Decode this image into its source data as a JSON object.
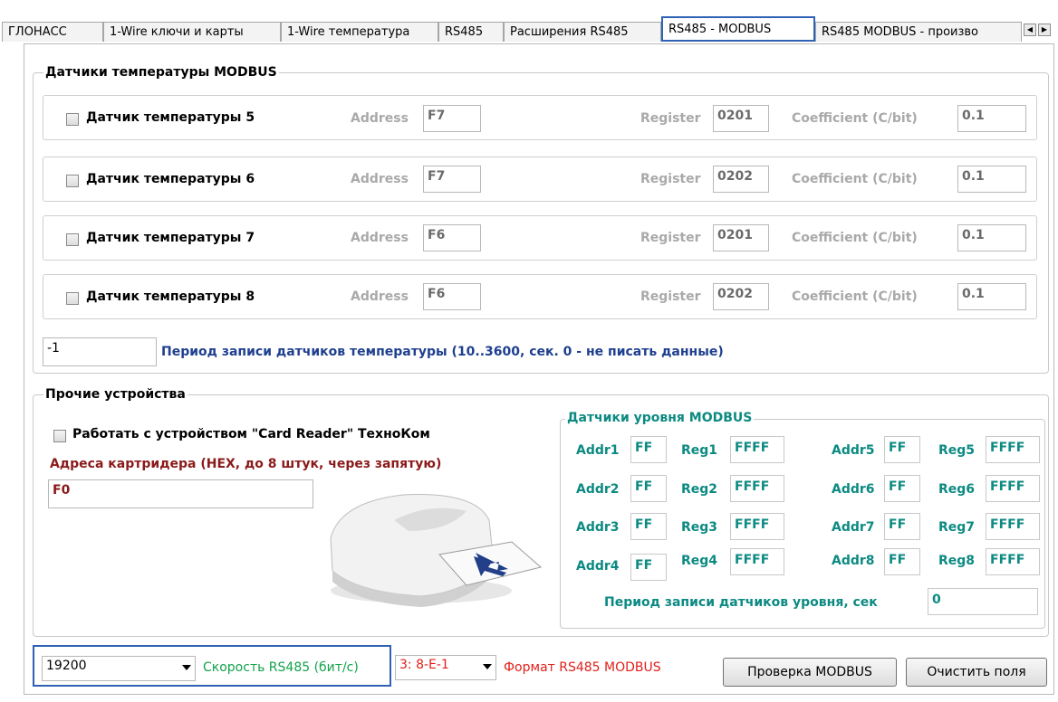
{
  "tabs": [
    {
      "label": "ГЛОНАСС"
    },
    {
      "label": "1-Wire ключи и карты"
    },
    {
      "label": "1-Wire температура"
    },
    {
      "label": "RS485"
    },
    {
      "label": "Расширения RS485"
    },
    {
      "label": "RS485 - MODBUS",
      "active": true
    },
    {
      "label": "RS485 MODBUS - произво"
    }
  ],
  "temp_group": {
    "title": "Датчики температуры MODBUS",
    "sensors": [
      {
        "label": "Датчик температуры 5",
        "address": "F7",
        "register": "0201",
        "coeff": "0.1"
      },
      {
        "label": "Датчик температуры 6",
        "address": "F7",
        "register": "0202",
        "coeff": "0.1"
      },
      {
        "label": "Датчик температуры 7",
        "address": "F6",
        "register": "0201",
        "coeff": "0.1"
      },
      {
        "label": "Датчик температуры 8",
        "address": "F6",
        "register": "0202",
        "coeff": "0.1"
      }
    ],
    "address_label": "Address",
    "register_label": "Register",
    "coeff_label": "Coefficient (C/bit)",
    "period_value": "-1",
    "period_label": "Период записи датчиков температуры (10..3600, сек. 0 - не писать данные)"
  },
  "other_group": {
    "title": "Прочие устройства",
    "card_reader_label": "Работать с устройством \"Card Reader\" ТехноКом",
    "addresses_label": "Адреса картридера (HEX, до 8 штук, через запятую)",
    "addresses_value": "F0"
  },
  "level_group": {
    "title": "Датчики уровня MODBUS",
    "left": [
      {
        "addr_label": "Addr1",
        "addr": "FF",
        "reg_label": "Reg1",
        "reg": "FFFF"
      },
      {
        "addr_label": "Addr2",
        "addr": "FF",
        "reg_label": "Reg2",
        "reg": "FFFF"
      },
      {
        "addr_label": "Addr3",
        "addr": "FF",
        "reg_label": "Reg3",
        "reg": "FFFF"
      },
      {
        "addr_label": "Addr4",
        "addr": "FF",
        "reg_label": "Reg4",
        "reg": "FFFF"
      }
    ],
    "right": [
      {
        "addr_label": "Addr5",
        "addr": "FF",
        "reg_label": "Reg5",
        "reg": "FFFF"
      },
      {
        "addr_label": "Addr6",
        "addr": "FF",
        "reg_label": "Reg6",
        "reg": "FFFF"
      },
      {
        "addr_label": "Addr7",
        "addr": "FF",
        "reg_label": "Reg7",
        "reg": "FFFF"
      },
      {
        "addr_label": "Addr8",
        "addr": "FF",
        "reg_label": "Reg8",
        "reg": "FFFF"
      }
    ],
    "period_label": "Период записи датчиков уровня, сек",
    "period_value": "0"
  },
  "bottom": {
    "speed_value": "19200",
    "speed_label": "Скорость RS485 (бит/с)",
    "format_value": "3:  8-E-1",
    "format_label": "Формат RS485 MODBUS",
    "check_button": "Проверка MODBUS",
    "clear_button": "Очистить поля"
  },
  "colors": {
    "active_tab": "#2f62b4",
    "label_blue": "#1f3f8f",
    "label_red": "#8b1a1a",
    "teal": "#0c8a82",
    "green": "#12a34a",
    "red": "#e0201b"
  }
}
